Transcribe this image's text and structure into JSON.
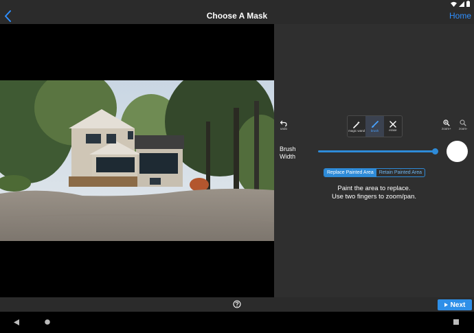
{
  "header": {
    "title": "Choose A Mask",
    "home_label": "Home"
  },
  "toolbar": {
    "undo_label": "undo",
    "tools": [
      {
        "label": "magic wand",
        "active": false
      },
      {
        "label": "brush",
        "active": true
      },
      {
        "label": "erase",
        "active": false
      }
    ],
    "zoom_in_label": "zoom+",
    "zoom_out_label": "zoom-"
  },
  "brush": {
    "label_line1": "Brush",
    "label_line2": "Width",
    "width_fraction": 1.0
  },
  "mode": {
    "options": [
      "Replace Painted Area",
      "Retain Painted Area"
    ],
    "selected": "Replace Painted Area"
  },
  "instructions": {
    "line1": "Paint the area to replace.",
    "line2": "Use two fingers to zoom/pan."
  },
  "footer": {
    "next_label": "Next"
  },
  "colors": {
    "accent": "#2e8bd8",
    "background": "#2f2f2f",
    "link": "#2f8fff"
  }
}
